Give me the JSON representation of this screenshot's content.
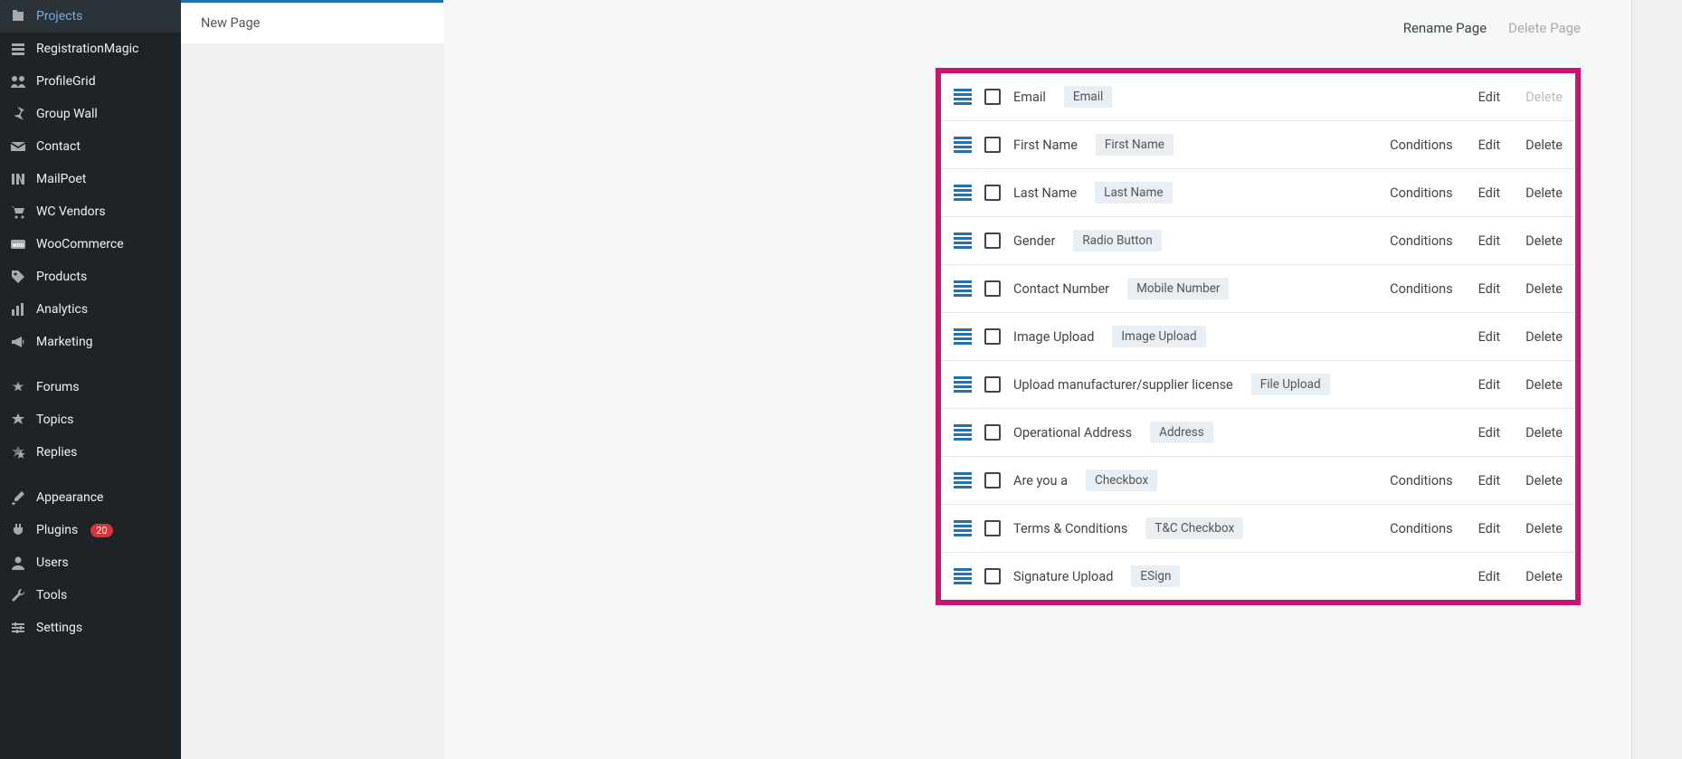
{
  "sidebar": {
    "items": [
      {
        "label": "Projects",
        "icon": "projects"
      },
      {
        "label": "RegistrationMagic",
        "icon": "registrationmagic"
      },
      {
        "label": "ProfileGrid",
        "icon": "profilegrid"
      },
      {
        "label": "Group Wall",
        "icon": "pin"
      },
      {
        "label": "Contact",
        "icon": "mail"
      },
      {
        "label": "MailPoet",
        "icon": "mailpoet"
      },
      {
        "label": "WC Vendors",
        "icon": "cart"
      },
      {
        "label": "WooCommerce",
        "icon": "woo"
      },
      {
        "label": "Products",
        "icon": "tag"
      },
      {
        "label": "Analytics",
        "icon": "analytics"
      },
      {
        "label": "Marketing",
        "icon": "marketing"
      }
    ],
    "items2": [
      {
        "label": "Forums",
        "icon": "forums"
      },
      {
        "label": "Topics",
        "icon": "topics"
      },
      {
        "label": "Replies",
        "icon": "replies"
      }
    ],
    "items3": [
      {
        "label": "Appearance",
        "icon": "brush"
      },
      {
        "label": "Plugins",
        "icon": "plug",
        "badge": "20"
      },
      {
        "label": "Users",
        "icon": "user"
      },
      {
        "label": "Tools",
        "icon": "tools"
      },
      {
        "label": "Settings",
        "icon": "settings"
      }
    ]
  },
  "left_panel": {
    "new_page": "New Page"
  },
  "top": {
    "rename": "Rename Page",
    "delete": "Delete Page"
  },
  "labels": {
    "conditions": "Conditions",
    "edit": "Edit",
    "delete": "Delete"
  },
  "fields": [
    {
      "name": "Email",
      "type": "Email",
      "conditions": false,
      "delete_enabled": false
    },
    {
      "name": "First Name",
      "type": "First Name",
      "conditions": true,
      "delete_enabled": true
    },
    {
      "name": "Last Name",
      "type": "Last Name",
      "conditions": true,
      "delete_enabled": true
    },
    {
      "name": "Gender",
      "type": "Radio Button",
      "conditions": true,
      "delete_enabled": true
    },
    {
      "name": "Contact Number",
      "type": "Mobile Number",
      "conditions": true,
      "delete_enabled": true
    },
    {
      "name": "Image Upload",
      "type": "Image Upload",
      "conditions": false,
      "delete_enabled": true
    },
    {
      "name": "Upload manufacturer/supplier license",
      "type": "File Upload",
      "conditions": false,
      "delete_enabled": true
    },
    {
      "name": "Operational Address",
      "type": "Address",
      "conditions": false,
      "delete_enabled": true
    },
    {
      "name": "Are you a",
      "type": "Checkbox",
      "conditions": true,
      "delete_enabled": true
    },
    {
      "name": "Terms & Conditions",
      "type": "T&C Checkbox",
      "conditions": true,
      "delete_enabled": true
    },
    {
      "name": "Signature Upload",
      "type": "ESign",
      "conditions": false,
      "delete_enabled": true
    }
  ]
}
